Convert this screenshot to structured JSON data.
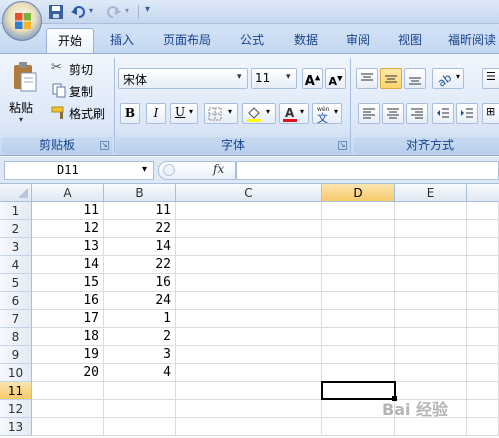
{
  "ribbon_tabs": [
    "开始",
    "插入",
    "页面布局",
    "公式",
    "数据",
    "审阅",
    "视图",
    "福昕阅读"
  ],
  "clipboard": {
    "paste_label": "粘贴",
    "cut_label": "剪切",
    "copy_label": "复制",
    "format_painter_label": "格式刷",
    "group_label": "剪贴板"
  },
  "font": {
    "name": "宋体",
    "size": "11",
    "bold": "B",
    "italic": "I",
    "underline": "U",
    "group_label": "字体"
  },
  "alignment": {
    "group_label": "对齐方式"
  },
  "formula_bar": {
    "name_box": "D11",
    "fx": "fx",
    "formula": ""
  },
  "sheet": {
    "columns": [
      "A",
      "B",
      "C",
      "D",
      "E"
    ],
    "selected_column": "D",
    "selected_row": "11",
    "rows": [
      {
        "num": "1",
        "a": "11",
        "b": "11"
      },
      {
        "num": "2",
        "a": "12",
        "b": "22"
      },
      {
        "num": "3",
        "a": "13",
        "b": "14"
      },
      {
        "num": "4",
        "a": "14",
        "b": "22"
      },
      {
        "num": "5",
        "a": "15",
        "b": "16"
      },
      {
        "num": "6",
        "a": "16",
        "b": "24"
      },
      {
        "num": "7",
        "a": "17",
        "b": "1"
      },
      {
        "num": "8",
        "a": "18",
        "b": "2"
      },
      {
        "num": "9",
        "a": "19",
        "b": "3"
      },
      {
        "num": "10",
        "a": "20",
        "b": "4"
      },
      {
        "num": "11",
        "a": "",
        "b": ""
      },
      {
        "num": "12",
        "a": "",
        "b": ""
      },
      {
        "num": "13",
        "a": "",
        "b": ""
      }
    ]
  },
  "watermark": "Bai 经验",
  "colors": {
    "accent": "#15428b",
    "selection_header": "#f7c96a",
    "ribbon_bg": "#dbe7f7"
  }
}
